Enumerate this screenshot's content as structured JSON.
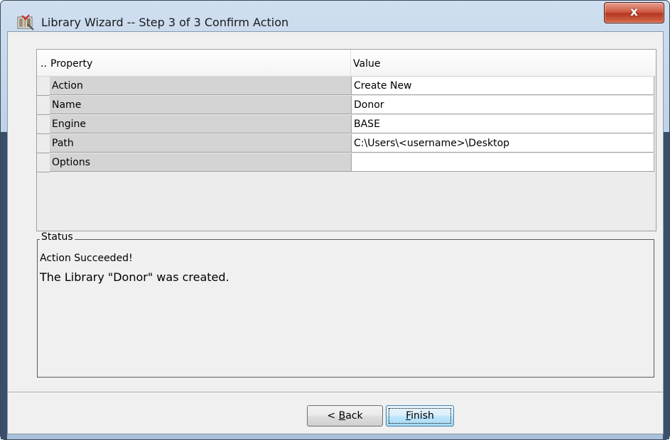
{
  "window": {
    "title": "Library Wizard  -- Step 3 of 3  Confirm Action",
    "close_symbol": "x",
    "icon": "library-wizard-icon"
  },
  "grid": {
    "header_dots": "..",
    "columns": [
      "Property",
      "Value"
    ],
    "rows": [
      {
        "property": "Action",
        "value": "Create New"
      },
      {
        "property": "Name",
        "value": "Donor"
      },
      {
        "property": "Engine",
        "value": "BASE"
      },
      {
        "property": "Path",
        "value": "C:\\Users\\<username>\\Desktop"
      },
      {
        "property": "Options",
        "value": ""
      }
    ]
  },
  "status": {
    "legend": "Status",
    "line1": "Action Succeeded!",
    "line2": "The Library \"Donor\" was created."
  },
  "buttons": {
    "back_prefix": "< ",
    "back_mnemonic": "B",
    "back_rest": "ack",
    "finish_mnemonic": "F",
    "finish_rest": "inish"
  },
  "colors": {
    "close_button": "#c8452e",
    "title_gradient_top": "#cfdff0",
    "property_cell": "#d4d4d4",
    "default_button_border": "#3c7fb1"
  }
}
